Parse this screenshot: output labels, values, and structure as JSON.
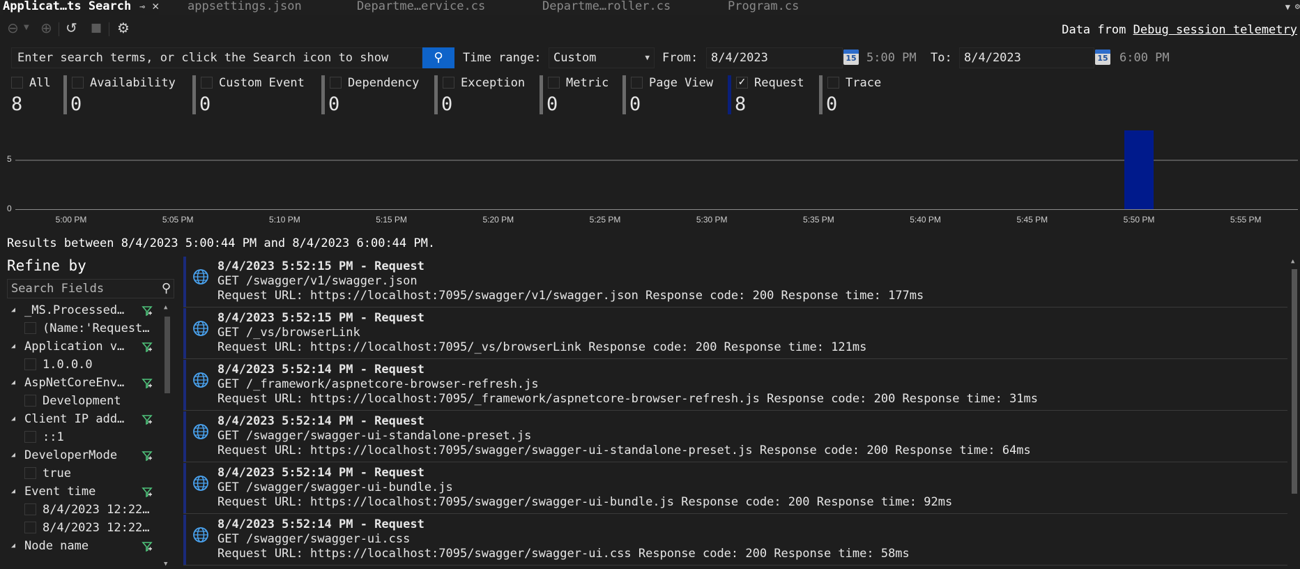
{
  "tabs": [
    {
      "label": "Applicat…ts Search",
      "active": true,
      "pin": "⊸",
      "close": "✕"
    },
    {
      "label": "appsettings.json"
    },
    {
      "label": "Departme…ervice.cs"
    },
    {
      "label": "Departme…roller.cs"
    },
    {
      "label": "Program.cs"
    }
  ],
  "toolbar": {
    "icons": [
      "back-icon",
      "forward-icon",
      "refresh-icon",
      "stop-icon",
      "settings-icon"
    ],
    "data_from_label": "Data from",
    "data_from_link": "Debug session telemetry"
  },
  "search": {
    "placeholder": "Enter search terms, or click the Search icon to show",
    "time_range_label": "Time range:",
    "time_range_value": "Custom",
    "from_label": "From:",
    "from_date": "8/4/2023",
    "from_time": "5:00 PM",
    "to_label": "To:",
    "to_date": "8/4/2023",
    "to_time": "6:00 PM",
    "calendar_day": "15"
  },
  "filters": [
    {
      "name": "All",
      "count": "8",
      "checked": false
    },
    {
      "name": "Availability",
      "count": "0",
      "checked": false
    },
    {
      "name": "Custom Event",
      "count": "0",
      "checked": false
    },
    {
      "name": "Dependency",
      "count": "0",
      "checked": false
    },
    {
      "name": "Exception",
      "count": "0",
      "checked": false
    },
    {
      "name": "Metric",
      "count": "0",
      "checked": false
    },
    {
      "name": "Page View",
      "count": "0",
      "checked": false
    },
    {
      "name": "Request",
      "count": "8",
      "checked": true
    },
    {
      "name": "Trace",
      "count": "0",
      "checked": false
    }
  ],
  "chart_data": {
    "type": "bar",
    "categories": [
      "5:00 PM",
      "5:05 PM",
      "5:10 PM",
      "5:15 PM",
      "5:20 PM",
      "5:25 PM",
      "5:30 PM",
      "5:35 PM",
      "5:40 PM",
      "5:45 PM",
      "5:50 PM",
      "5:55 PM"
    ],
    "values": [
      0,
      0,
      0,
      0,
      0,
      0,
      0,
      0,
      0,
      0,
      8,
      0
    ],
    "yticks": [
      "0",
      "5"
    ],
    "ylim": [
      0,
      8
    ],
    "bar_color": "#001a8c",
    "grid": true
  },
  "results_summary": "Results between 8/4/2023 5:00:44 PM and 8/4/2023 6:00:44 PM.",
  "refine": {
    "title": "Refine by",
    "search_placeholder": "Search Fields",
    "groups": [
      {
        "name": "_MS.Processed…",
        "values": [
          "(Name:'Request…"
        ]
      },
      {
        "name": "Application v…",
        "values": [
          "1.0.0.0"
        ]
      },
      {
        "name": "AspNetCoreEnv…",
        "values": [
          "Development"
        ]
      },
      {
        "name": "Client IP add…",
        "values": [
          "::1"
        ]
      },
      {
        "name": "DeveloperMode",
        "values": [
          "true"
        ]
      },
      {
        "name": "Event time",
        "values": [
          "8/4/2023 12:22…",
          "8/4/2023 12:22…"
        ]
      },
      {
        "name": "Node name",
        "values": []
      }
    ]
  },
  "results": [
    {
      "title": "8/4/2023 5:52:15 PM - Request",
      "path": "GET /swagger/v1/swagger.json",
      "detail": "Request URL: https://localhost:7095/swagger/v1/swagger.json  Response code: 200  Response time: 177ms"
    },
    {
      "title": "8/4/2023 5:52:15 PM - Request",
      "path": "GET /_vs/browserLink",
      "detail": "Request URL: https://localhost:7095/_vs/browserLink  Response code: 200  Response time: 121ms"
    },
    {
      "title": "8/4/2023 5:52:14 PM - Request",
      "path": "GET /_framework/aspnetcore-browser-refresh.js",
      "detail": "Request URL: https://localhost:7095/_framework/aspnetcore-browser-refresh.js  Response code: 200  Response time: 31ms"
    },
    {
      "title": "8/4/2023 5:52:14 PM - Request",
      "path": "GET /swagger/swagger-ui-standalone-preset.js",
      "detail": "Request URL: https://localhost:7095/swagger/swagger-ui-standalone-preset.js  Response code: 200  Response time: 64ms"
    },
    {
      "title": "8/4/2023 5:52:14 PM - Request",
      "path": "GET /swagger/swagger-ui-bundle.js",
      "detail": "Request URL: https://localhost:7095/swagger/swagger-ui-bundle.js  Response code: 200  Response time: 92ms"
    },
    {
      "title": "8/4/2023 5:52:14 PM - Request",
      "path": "GET /swagger/swagger-ui.css",
      "detail": "Request URL: https://localhost:7095/swagger/swagger-ui.css  Response code: 200  Response time: 58ms"
    }
  ]
}
